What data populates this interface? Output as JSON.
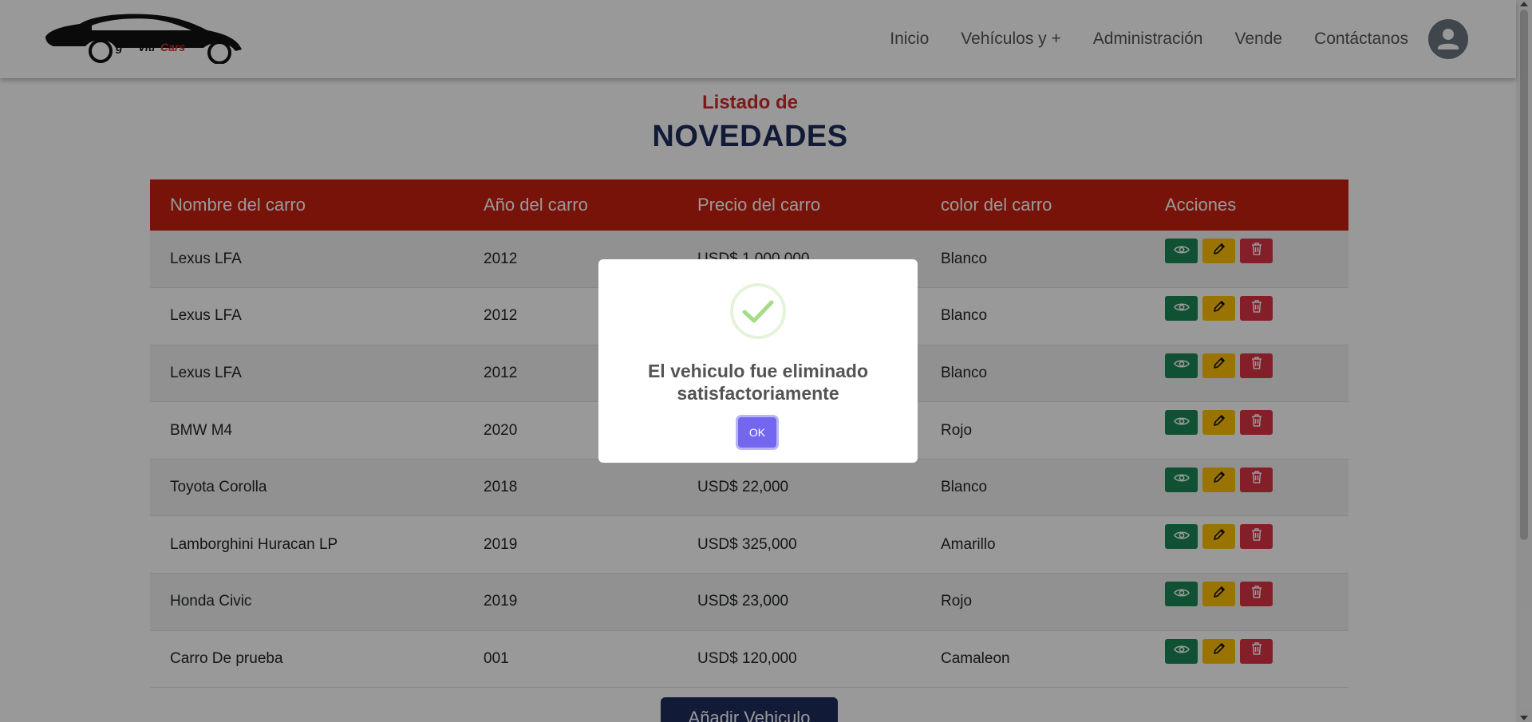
{
  "brand": {
    "logo_text_a": "g'",
    "logo_text_b": "Viti",
    "logo_text_c": "Cars"
  },
  "nav": {
    "items": [
      "Inicio",
      "Vehículos y +",
      "Administración",
      "Vende",
      "Contáctanos"
    ],
    "avatar_icon": "user-icon"
  },
  "heading": {
    "subtitle": "Listado de",
    "title": "NOVEDADES"
  },
  "table": {
    "headers": [
      "Nombre del carro",
      "Año del carro",
      "Precio del carro",
      "color del carro",
      "Acciones"
    ],
    "rows": [
      {
        "name": "Lexus LFA",
        "year": "2012",
        "price": "USD$ 1,000,000",
        "color": "Blanco"
      },
      {
        "name": "Lexus LFA",
        "year": "2012",
        "price": "",
        "color": "Blanco"
      },
      {
        "name": "Lexus LFA",
        "year": "2012",
        "price": "",
        "color": "Blanco"
      },
      {
        "name": "BMW M4",
        "year": "2020",
        "price": "",
        "color": "Rojo"
      },
      {
        "name": "Toyota Corolla",
        "year": "2018",
        "price": "USD$ 22,000",
        "color": "Blanco"
      },
      {
        "name": "Lamborghini Huracan LP",
        "year": "2019",
        "price": "USD$ 325,000",
        "color": "Amarillo"
      },
      {
        "name": "Honda Civic",
        "year": "2019",
        "price": "USD$ 23,000",
        "color": "Rojo"
      },
      {
        "name": "Carro De prueba",
        "year": "001",
        "price": "USD$ 120,000",
        "color": "Camaleon"
      }
    ],
    "action_icons": [
      "eye-icon",
      "pencil-icon",
      "trash-icon"
    ]
  },
  "add_button": "Añadir Vehiculo",
  "modal": {
    "message": "El vehiculo fue eliminado satisfactoriamente",
    "ok_label": "OK",
    "icon": "success-check-icon"
  },
  "colors": {
    "header_red": "#c7210f",
    "subtitle_red": "#d22a2a",
    "navy": "#1d2c5c",
    "view_green": "#198754",
    "edit_yellow": "#ffc107",
    "delete_red": "#dc3545",
    "ok_purple": "#7367f0"
  }
}
